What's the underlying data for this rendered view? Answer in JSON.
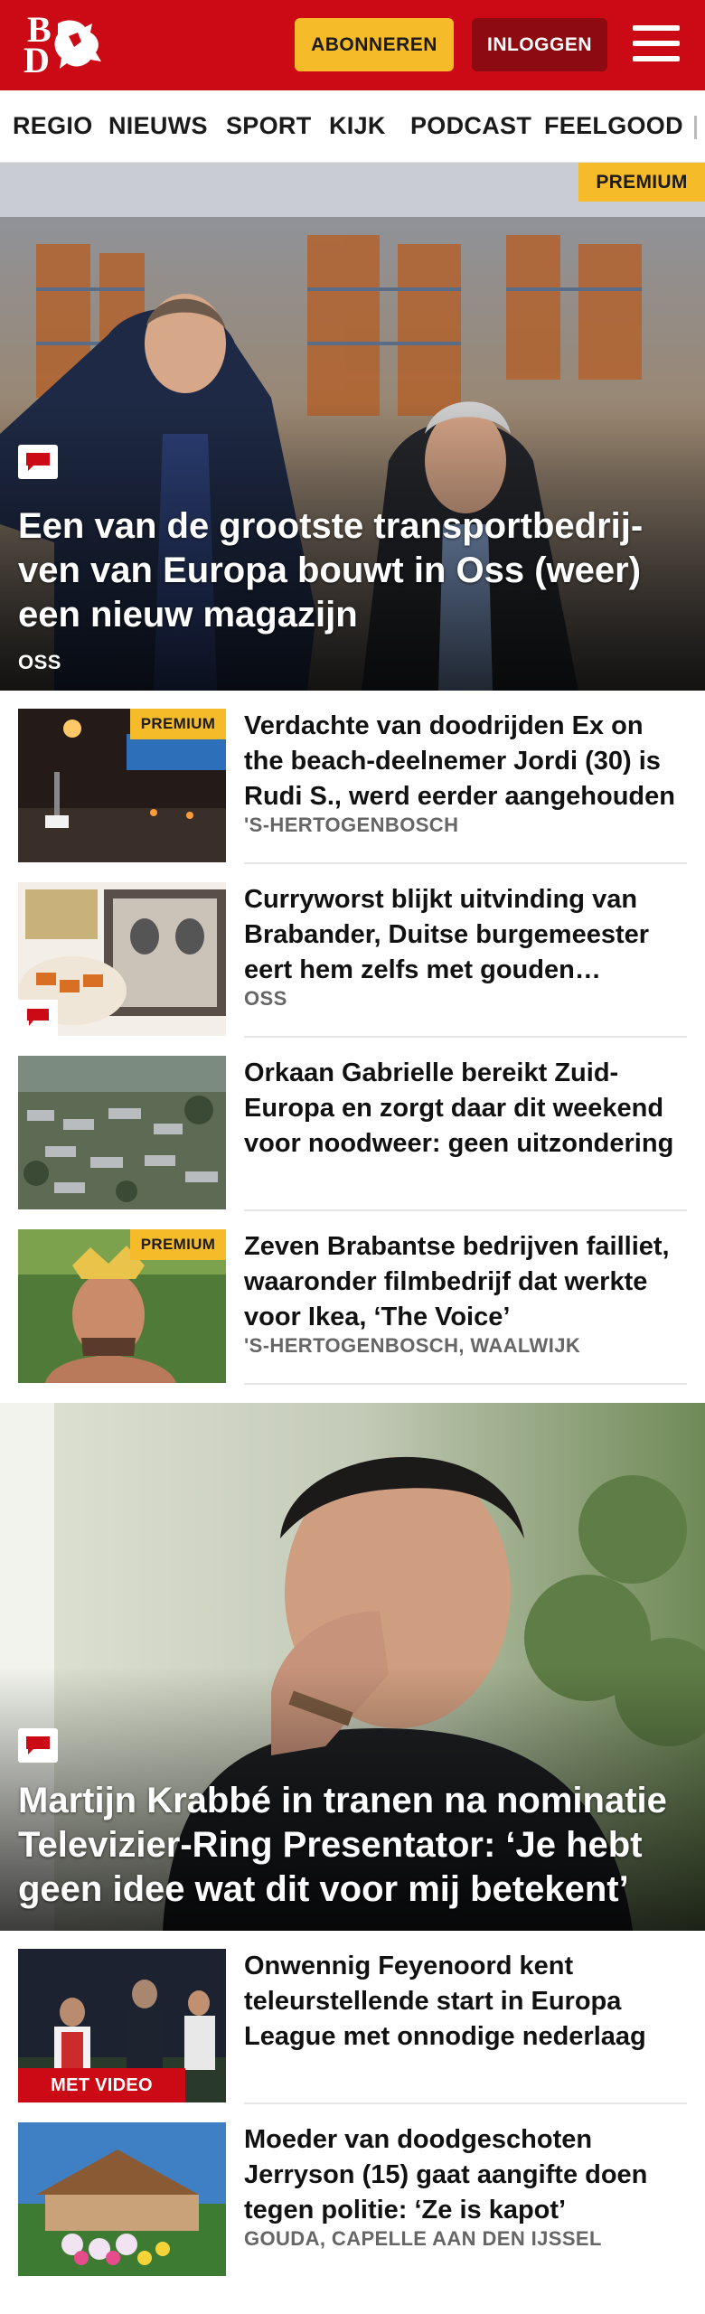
{
  "header": {
    "logo_text": "BD",
    "subscribe_label": "ABONNEREN",
    "login_label": "INLOGGEN",
    "menu_icon": "hamburger-menu-icon",
    "brand_color": "#cc0a15",
    "accent_color": "#f5bb29"
  },
  "nav": {
    "items": [
      "REGIO",
      "NIEUWS",
      "SPORT",
      "KIJK",
      "PODCAST",
      "FEELGOOD"
    ]
  },
  "hero1": {
    "premium_label": "PREMIUM",
    "title": "Een van de grootste transportbedrij­ven van Europa bouwt in Oss (weer) een nieuw magazijn",
    "location": "OSS",
    "comment_icon": "comment-icon"
  },
  "articles": [
    {
      "title": "Verdachte van doodrijden Ex on the beach-deelnemer Jordi (30) is Rudi S., werd eerder aangehouden",
      "location": "'S-HERTOGENBOSCH",
      "premium_label": "PREMIUM"
    },
    {
      "title": "Curryworst blijkt uitvinding van Brabander, Duitse burgemeester eert hem zelfs met gouden plaquette",
      "location": "OSS"
    },
    {
      "title": "Orkaan Gabrielle bereikt Zuid-Europa en zorgt daar dit weekend voor noodweer: geen uitzonde­ring",
      "location": ""
    },
    {
      "title": "Zeven Brabantse bedrijven failliet, waaronder filmbedrijf dat werkte voor Ikea, ‘The Voice’",
      "location": "'S-HERTOGENBOSCH, WAALWIJK",
      "premium_label": "PREMIUM"
    },
    {
      "title": "Onwennig Feyenoord kent teleurstellende start in Europa League met onnodige nederlaag",
      "location": "",
      "video_label": "MET VIDEO"
    },
    {
      "title": "Moeder van doodgeschoten Jerryson (15) gaat aangifte doen tegen politie: ‘Ze is kapot’",
      "location": "GOUDA, CAPELLE AAN DEN IJSSEL"
    }
  ],
  "hero2": {
    "title": "Martijn Krabbé in tranen na nominatie Televizier-Ring Presentator: ‘Je hebt geen idee wat dit voor mij betekent’",
    "comment_icon": "comment-icon"
  }
}
